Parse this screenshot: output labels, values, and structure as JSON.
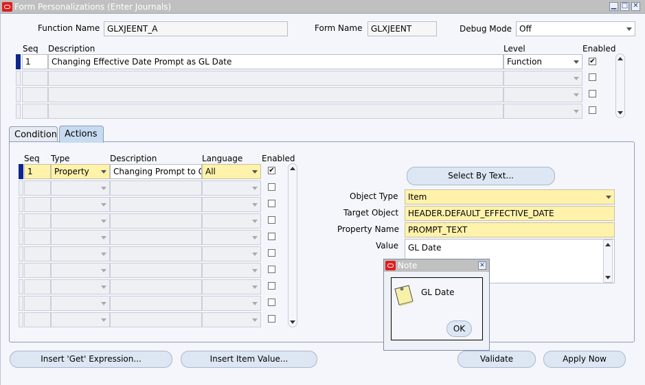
{
  "window": {
    "title": "Form Personalizations (Enter Journals)",
    "minimize": "▁",
    "maximize": "□",
    "close": "✕"
  },
  "header": {
    "function_name_label": "Function Name",
    "function_name_value": "GLXJEENT_A",
    "form_name_label": "Form Name",
    "form_name_value": "GLXJEENT",
    "debug_mode_label": "Debug Mode",
    "debug_mode_value": "Off"
  },
  "rules_table": {
    "columns": {
      "seq": "Seq",
      "description": "Description",
      "level": "Level",
      "enabled": "Enabled"
    },
    "rows": [
      {
        "seq": "1",
        "description": "Changing Effective Date Prompt as GL Date",
        "level": "Function",
        "enabled": "✔"
      },
      {
        "seq": "",
        "description": "",
        "level": "",
        "enabled": ""
      },
      {
        "seq": "",
        "description": "",
        "level": "",
        "enabled": ""
      },
      {
        "seq": "",
        "description": "",
        "level": "",
        "enabled": ""
      }
    ]
  },
  "tabs": {
    "condition": "Condition",
    "actions": "Actions"
  },
  "actions_table": {
    "columns": {
      "seq": "Seq",
      "type": "Type",
      "description": "Description",
      "language": "Language",
      "enabled": "Enabled"
    },
    "rows": [
      {
        "seq": "1",
        "type": "Property",
        "description": "Changing Prompt to G",
        "language": "All",
        "enabled": "✔"
      },
      {
        "seq": "",
        "type": "",
        "description": "",
        "language": "",
        "enabled": ""
      },
      {
        "seq": "",
        "type": "",
        "description": "",
        "language": "",
        "enabled": ""
      },
      {
        "seq": "",
        "type": "",
        "description": "",
        "language": "",
        "enabled": ""
      },
      {
        "seq": "",
        "type": "",
        "description": "",
        "language": "",
        "enabled": ""
      },
      {
        "seq": "",
        "type": "",
        "description": "",
        "language": "",
        "enabled": ""
      },
      {
        "seq": "",
        "type": "",
        "description": "",
        "language": "",
        "enabled": ""
      },
      {
        "seq": "",
        "type": "",
        "description": "",
        "language": "",
        "enabled": ""
      },
      {
        "seq": "",
        "type": "",
        "description": "",
        "language": "",
        "enabled": ""
      },
      {
        "seq": "",
        "type": "",
        "description": "",
        "language": "",
        "enabled": ""
      }
    ]
  },
  "property": {
    "select_by_text_button": "Select By Text...",
    "object_type_label": "Object Type",
    "object_type_value": "Item",
    "target_object_label": "Target Object",
    "target_object_value": "HEADER.DEFAULT_EFFECTIVE_DATE",
    "property_name_label": "Property Name",
    "property_name_value": "PROMPT_TEXT",
    "value_label": "Value",
    "value_value": "GL Date"
  },
  "note_dialog": {
    "title": "Note",
    "message": "GL Date",
    "ok_button": "OK"
  },
  "footer": {
    "insert_get_expression": "Insert 'Get' Expression...",
    "insert_item_value": "Insert Item Value...",
    "validate": "Validate",
    "apply_now": "Apply Now"
  }
}
